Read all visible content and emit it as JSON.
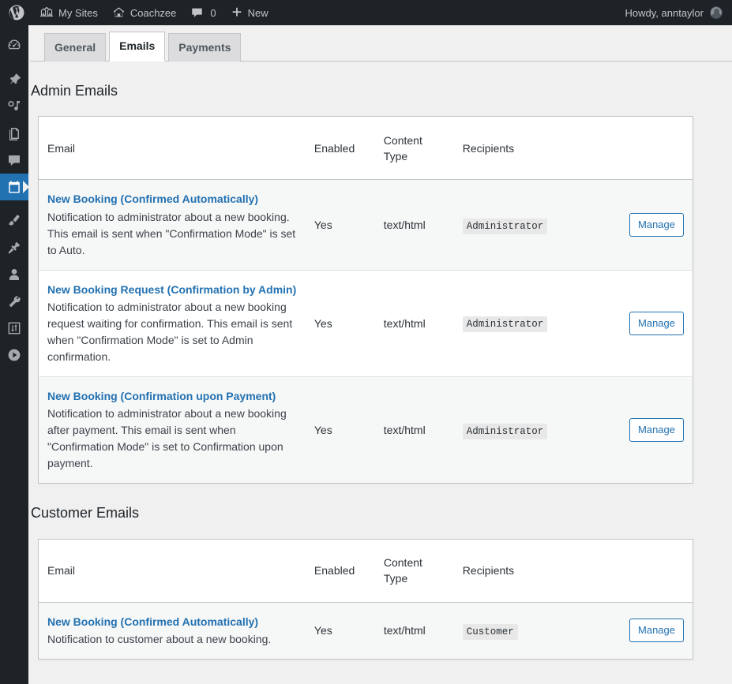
{
  "adminbar": {
    "wp_logo": "wordpress-logo",
    "my_sites": "My Sites",
    "site_name": "Coachzee",
    "comment_count": "0",
    "new_label": "New",
    "howdy": "Howdy, anntaylor"
  },
  "adminmenu": {
    "items": [
      {
        "name": "dashboard",
        "icon": "dashboard-icon",
        "current": false
      },
      {
        "name": "posts",
        "icon": "pin-icon",
        "current": false
      },
      {
        "name": "media",
        "icon": "media-icon",
        "current": false
      },
      {
        "name": "pages",
        "icon": "pages-icon",
        "current": false
      },
      {
        "name": "comments",
        "icon": "comments-icon",
        "current": false
      },
      {
        "name": "bookings",
        "icon": "calendar-icon",
        "current": true
      },
      {
        "name": "appearance",
        "icon": "paintbrush-icon",
        "current": false
      },
      {
        "name": "plugins",
        "icon": "plugin-icon",
        "current": false
      },
      {
        "name": "users",
        "icon": "user-icon",
        "current": false
      },
      {
        "name": "tools",
        "icon": "wrench-icon",
        "current": false
      },
      {
        "name": "settings",
        "icon": "settings-icon",
        "current": false
      },
      {
        "name": "media-player",
        "icon": "play-circle-icon",
        "current": false
      }
    ]
  },
  "tabs": [
    {
      "label": "General",
      "active": false
    },
    {
      "label": "Emails",
      "active": true
    },
    {
      "label": "Payments",
      "active": false
    }
  ],
  "columns": {
    "email": "Email",
    "enabled": "Enabled",
    "content_type": "Content Type",
    "recipients": "Recipients"
  },
  "manage_label": "Manage",
  "sections": [
    {
      "title": "Admin Emails",
      "rows": [
        {
          "title": "New Booking (Confirmed Automatically)",
          "description": "Notification to administrator about a new booking. This email is sent when \"Confirmation Mode\" is set to Auto.",
          "enabled": "Yes",
          "content_type": "text/html",
          "recipients": "Administrator"
        },
        {
          "title": "New Booking Request (Confirmation by Admin)",
          "description": "Notification to administrator about a new booking request waiting for confirmation. This email is sent when \"Confirmation Mode\" is set to Admin confirmation.",
          "enabled": "Yes",
          "content_type": "text/html",
          "recipients": "Administrator"
        },
        {
          "title": "New Booking (Confirmation upon Payment)",
          "description": "Notification to administrator about a new booking after payment. This email is sent when \"Confirmation Mode\" is set to Confirmation upon payment.",
          "enabled": "Yes",
          "content_type": "text/html",
          "recipients": "Administrator"
        }
      ]
    },
    {
      "title": "Customer Emails",
      "rows": [
        {
          "title": "New Booking (Confirmed Automatically)",
          "description": "Notification to customer about a new booking.",
          "enabled": "Yes",
          "content_type": "text/html",
          "recipients": "Customer"
        }
      ]
    }
  ],
  "colors": {
    "wp_blue": "#2271b1",
    "adminbar_bg": "#1d2327",
    "content_bg": "#f0f0f1"
  }
}
